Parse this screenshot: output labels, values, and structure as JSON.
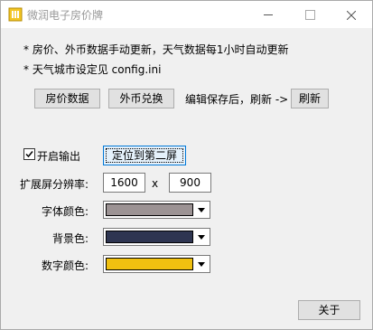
{
  "window": {
    "title": "微润电子房价牌",
    "icon": "app-icon",
    "controls": [
      "minimize",
      "maximize",
      "close"
    ]
  },
  "notes": {
    "line1": "* 房价、外币数据手动更新，天气数据每1小时自动更新",
    "line2": "* 天气城市设定见 config.ini"
  },
  "buttons": {
    "room_price": "房价数据",
    "currency": "外币兑换",
    "refresh_hint": "编辑保存后，刷新 ->",
    "refresh": "刷新",
    "locate_second_screen": "定位到第二屏",
    "about": "关于"
  },
  "output": {
    "enable_label": "开启输出",
    "enabled": true
  },
  "resolution": {
    "label": "扩展屏分辨率:",
    "width": "1600",
    "separator": "x",
    "height": "900"
  },
  "colors": {
    "font_label": "字体颜色:",
    "font_color": "#9c9394",
    "background_label": "背景色:",
    "background_color": "#2e3551",
    "number_label": "数字颜色:",
    "number_color": "#f0c010"
  }
}
